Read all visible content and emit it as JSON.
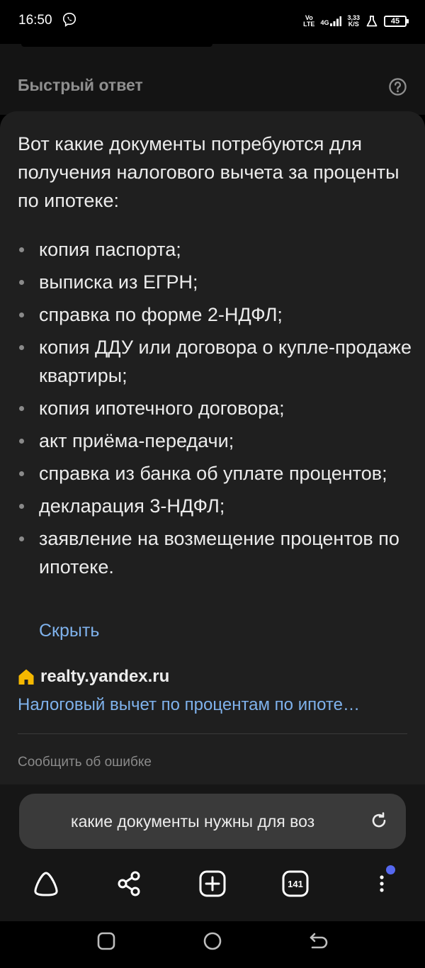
{
  "status": {
    "time": "16:50",
    "volte_top": "Vo",
    "volte_bottom": "LTE",
    "network": "4G",
    "speed_value": "3,33",
    "speed_unit": "K/S",
    "battery": "45"
  },
  "header": {
    "title": "Быстрый ответ",
    "help_icon": "help-circle-icon"
  },
  "answer": {
    "intro": "Вот какие документы потребуются для получения налогового вычета за проценты по ипотеке:",
    "items": [
      "копия паспорта;",
      "выписка из ЕГРН;",
      "справка по форме 2-НДФЛ;",
      "копия ДДУ или договора о купле-продаже квартиры;",
      "копия ипотечного договора;",
      "акт приёма-передачи;",
      "справка из банка об уплате процентов;",
      "декларация 3-НДФЛ;",
      "заявление на возмещение процентов по ипотеке."
    ],
    "hide_label": "Скрыть"
  },
  "source": {
    "domain": "realty.yandex.ru",
    "link_text": "Налоговый вычет по процентам по ипоте…",
    "icon": "house-icon",
    "icon_color": "#f5b800"
  },
  "report_label": "Сообщить об ошибке",
  "search": {
    "query": "какие документы нужны для воз",
    "icon": "reload-icon"
  },
  "toolbar": {
    "tabs_count": "141",
    "accent_dot_color": "#5568f0"
  },
  "colors": {
    "link": "#7fb2ec",
    "card": "#1f1f1f",
    "search_bar": "#3a3a3a"
  }
}
